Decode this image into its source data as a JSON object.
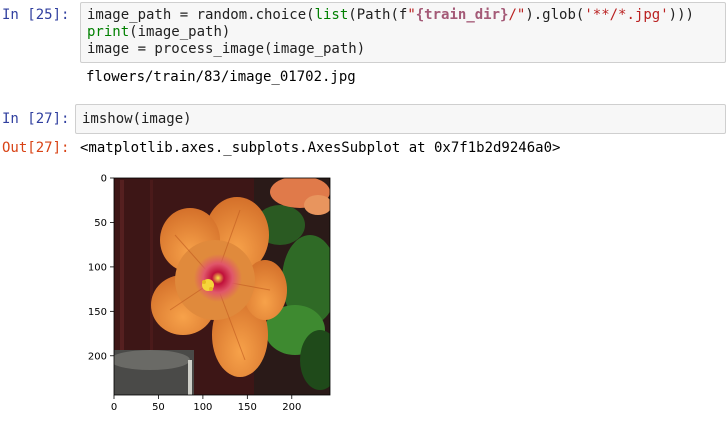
{
  "cells": [
    {
      "prompt": "In [25]:",
      "code_lines": [
        [
          {
            "t": "image_path = random.choice(",
            "c": ""
          },
          {
            "t": "list",
            "c": "builtin"
          },
          {
            "t": "(Path(f",
            "c": ""
          },
          {
            "t": "\"",
            "c": "str"
          },
          {
            "t": "{train_dir}",
            "c": "interp"
          },
          {
            "t": "/\"",
            "c": "str"
          },
          {
            "t": ").glob(",
            "c": ""
          },
          {
            "t": "'**/*.jpg'",
            "c": "str"
          },
          {
            "t": ")))",
            "c": ""
          }
        ],
        [
          {
            "t": "print",
            "c": "builtin"
          },
          {
            "t": "(image_path)",
            "c": ""
          }
        ],
        [
          {
            "t": "image = process_image(image_path)",
            "c": ""
          }
        ]
      ],
      "output": "flowers/train/83/image_01702.jpg"
    },
    {
      "prompt": "In [27]:",
      "code_lines": [
        [
          {
            "t": "imshow(image)",
            "c": ""
          }
        ]
      ],
      "out_prompt": "Out[27]:",
      "output": "<matplotlib.axes._subplots.AxesSubplot at 0x7f1b2d9246a0>",
      "plot": {
        "x_ticks": [
          "0",
          "50",
          "100",
          "150",
          "200"
        ],
        "y_ticks": [
          "0",
          "50",
          "100",
          "150",
          "200"
        ],
        "image_description_icon": "hibiscus-flower-photo"
      }
    }
  ],
  "colors": {
    "in_prompt": "#303f9f",
    "out_prompt": "#d84315",
    "builtin": "#008000",
    "string": "#ba2121",
    "interp": "#a45a77"
  }
}
